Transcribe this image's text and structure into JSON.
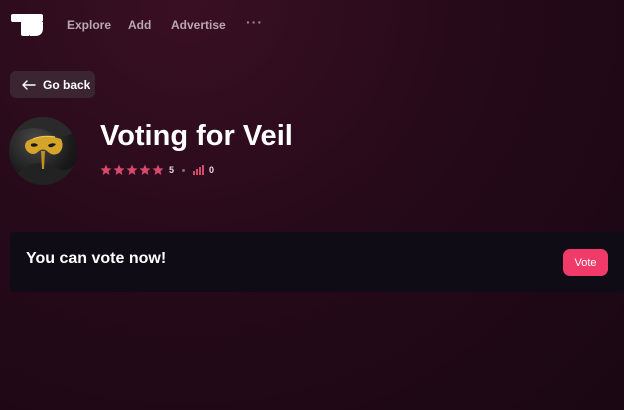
{
  "nav": {
    "items": [
      {
        "label": "Explore"
      },
      {
        "label": "Add"
      },
      {
        "label": "Advertise"
      }
    ],
    "more_label": "···"
  },
  "back_button": {
    "label": "Go back",
    "icon": "arrow-left-icon"
  },
  "profile": {
    "title": "Voting for Veil",
    "rating": "5",
    "rating_stars": 5,
    "votes": "0",
    "avatar_icon": "gold-mask-icon"
  },
  "vote_panel": {
    "message": "You can vote now!",
    "button_label": "Vote"
  },
  "colors": {
    "accent": "#f03b6a",
    "star": "#d64a6a",
    "panel_bg": "#0f0c15"
  }
}
